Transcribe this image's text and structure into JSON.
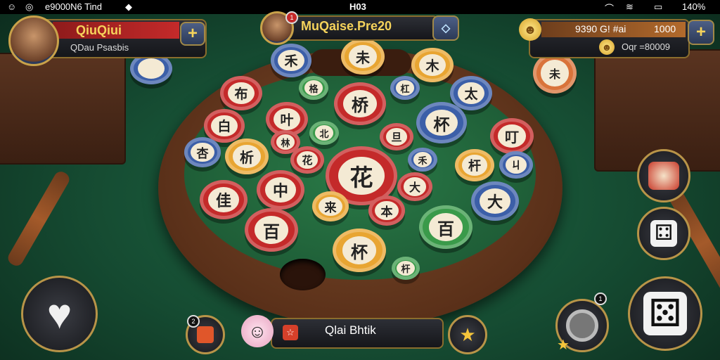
{
  "status_bar": {
    "left_text": "e9000N6 Ti⁠⁠nd",
    "center_text": "H03",
    "battery_text": "140%"
  },
  "player": {
    "name": "QiuQiui",
    "subtitle": "QDau Psasbis",
    "add_label": "+"
  },
  "opponent": {
    "title": "MuQaise.Pre20",
    "badge": "1"
  },
  "currency": {
    "primary_label": "9390 G! #ai",
    "primary_value": "1000",
    "secondary_label": "Oqr =80009",
    "add_label": "+"
  },
  "chat": {
    "text": "Qlai Bhtik",
    "left_badge": "2"
  },
  "right_badge": "1",
  "chip_glyphs": [
    "未",
    "禾",
    "木",
    "布",
    "格",
    "桥",
    "杠",
    "太",
    "白",
    "叶",
    "北",
    "旦",
    "杯",
    "叮",
    "杏",
    "析",
    "林",
    "花",
    "花",
    "禾",
    "杆",
    "ㄐ",
    "中",
    "大",
    "大",
    "佳",
    "来",
    "本",
    "百",
    "百",
    "杯",
    "杆",
    "朴",
    "来"
  ]
}
